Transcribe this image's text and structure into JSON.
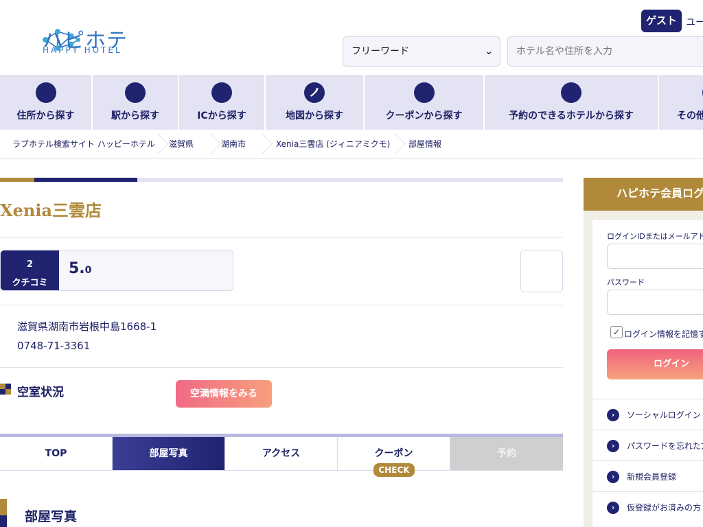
{
  "header": {
    "logo_jp": "ハピホテ",
    "logo_en": "HAPPY HOTEL",
    "guest_badge": "ゲスト",
    "user_link": "ユー",
    "search": {
      "select_value": "フリーワード",
      "input_placeholder": "ホテル名や住所を入力"
    }
  },
  "nav": {
    "items": [
      {
        "label": "住所から探す",
        "icon": "pin-icon"
      },
      {
        "label": "駅から探す",
        "icon": "train-icon"
      },
      {
        "label": "ICから探す",
        "icon": "car-icon"
      },
      {
        "label": "地図から探す",
        "icon": "japan-map-icon"
      },
      {
        "label": "クーポンから探す",
        "icon": "coupon-icon"
      },
      {
        "label": "予約のできるホテルから探す",
        "icon": "calendar-icon"
      },
      {
        "label": "その他",
        "icon": "more-icon"
      }
    ]
  },
  "breadcrumb": [
    "ラブホテル検索サイト ハッピーホテル",
    "滋賀県",
    "湖南市",
    "Xenia三雲店 (ジィニアミクモ)",
    "部屋情報"
  ],
  "hotel": {
    "name": "Xenia三雲店",
    "review_count": "2",
    "review_label": "クチコミ",
    "score_main": "5.",
    "score_sub": "0",
    "address": "滋賀県湖南市岩根中島1668-1",
    "phone": "0748-71-3361"
  },
  "vacancy": {
    "title": "空室状況",
    "button_label": "空満情報をみる"
  },
  "tabs": {
    "items": [
      "TOP",
      "部屋写真",
      "アクセス",
      "クーポン",
      "予約"
    ],
    "active_index": 1,
    "check_badge": "CHECK"
  },
  "section": {
    "photo_title": "部屋写真"
  },
  "login": {
    "heading": "ハピホテ会員ログ",
    "id_label": "ログインIDまたはメールアドレ",
    "password_label": "パスワード",
    "remember_label": "ログイン情報を記憶す",
    "button_label": "ログイン",
    "links": [
      "ソーシャルログイン",
      "パスワードを忘れた方",
      "新規会員登録",
      "仮登録がお済みの方"
    ]
  },
  "colors": {
    "navy": "#1f2370",
    "gold": "#b08a3a",
    "nav_bg": "#e3e3f3",
    "pink": "#f06a86"
  }
}
